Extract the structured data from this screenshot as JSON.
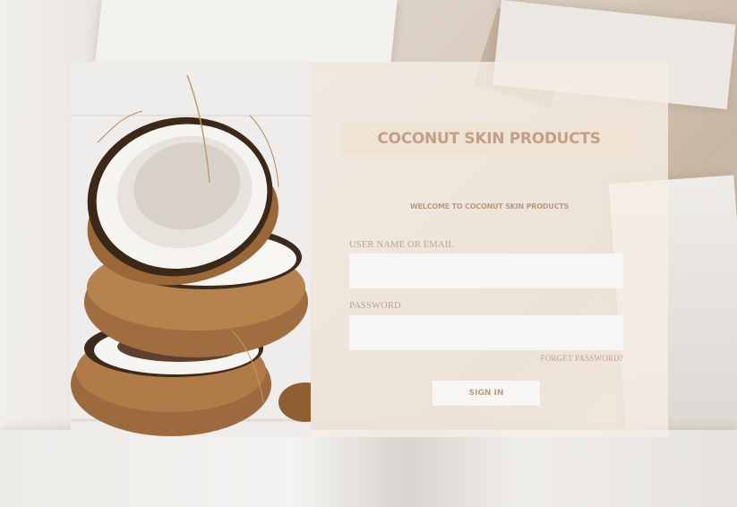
{
  "brand": {
    "title": "COCONUT SKIN PRODUCTS",
    "welcome": "WELCOME TO COCONUT SKIN PRODUCTS"
  },
  "form": {
    "username_label": "USER NAME OR EMAIL",
    "username_value": "",
    "password_label": "PASSWORD",
    "password_value": "",
    "forgot_label": "FORGET PASSWORD?",
    "signin_label": "SIGN IN"
  },
  "colors": {
    "accent_text": "#c0a088",
    "panel_bg": "#f6eee5",
    "field_bg": "#f7f6f5"
  }
}
